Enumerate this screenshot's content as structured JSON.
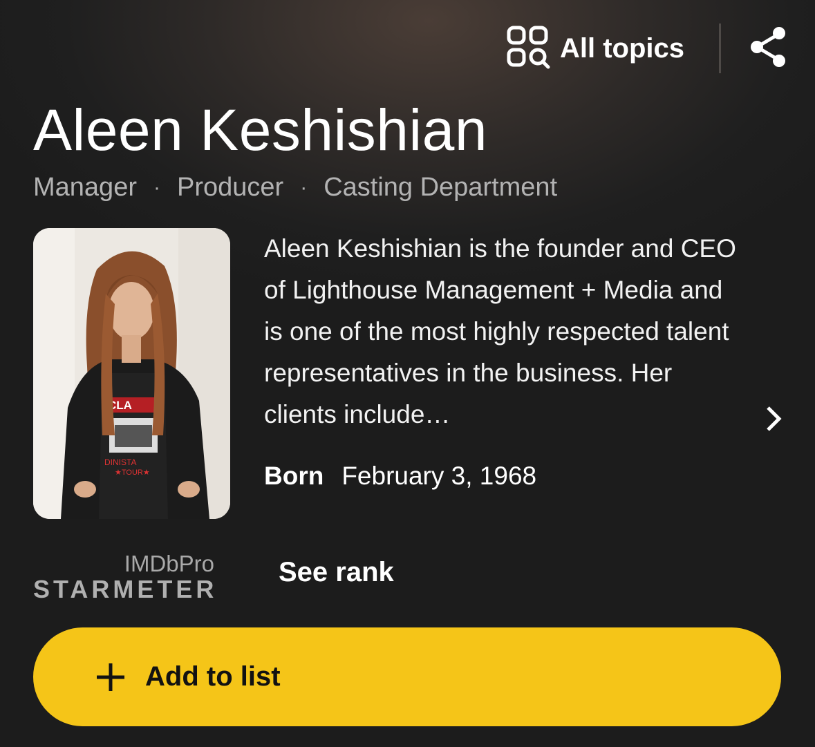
{
  "header": {
    "all_topics_label": "All topics",
    "all_topics_icon": "all-topics-icon",
    "share_icon": "share-icon"
  },
  "person": {
    "name": "Aleen Keshishian",
    "roles": [
      "Manager",
      "Producer",
      "Casting Department"
    ],
    "separator": "·",
    "bio": "Aleen Keshishian is the founder and CEO of Lighthouse Management + Media and is one of the most highly respected talent representatives in the business. Her clients include…",
    "born_label": "Born",
    "born_value": "February 3, 1968",
    "photo_shirt_text": [
      "CLA",
      "DINISTA",
      "★TOUR★"
    ]
  },
  "starmeter": {
    "brand_top": "IMDbPro",
    "brand_bottom": "STARMETER",
    "see_rank_label": "See rank"
  },
  "actions": {
    "add_to_list_label": "Add to list"
  },
  "colors": {
    "accent": "#f5c518",
    "background": "#1e1e1e",
    "muted_text": "#b3b3b3"
  }
}
